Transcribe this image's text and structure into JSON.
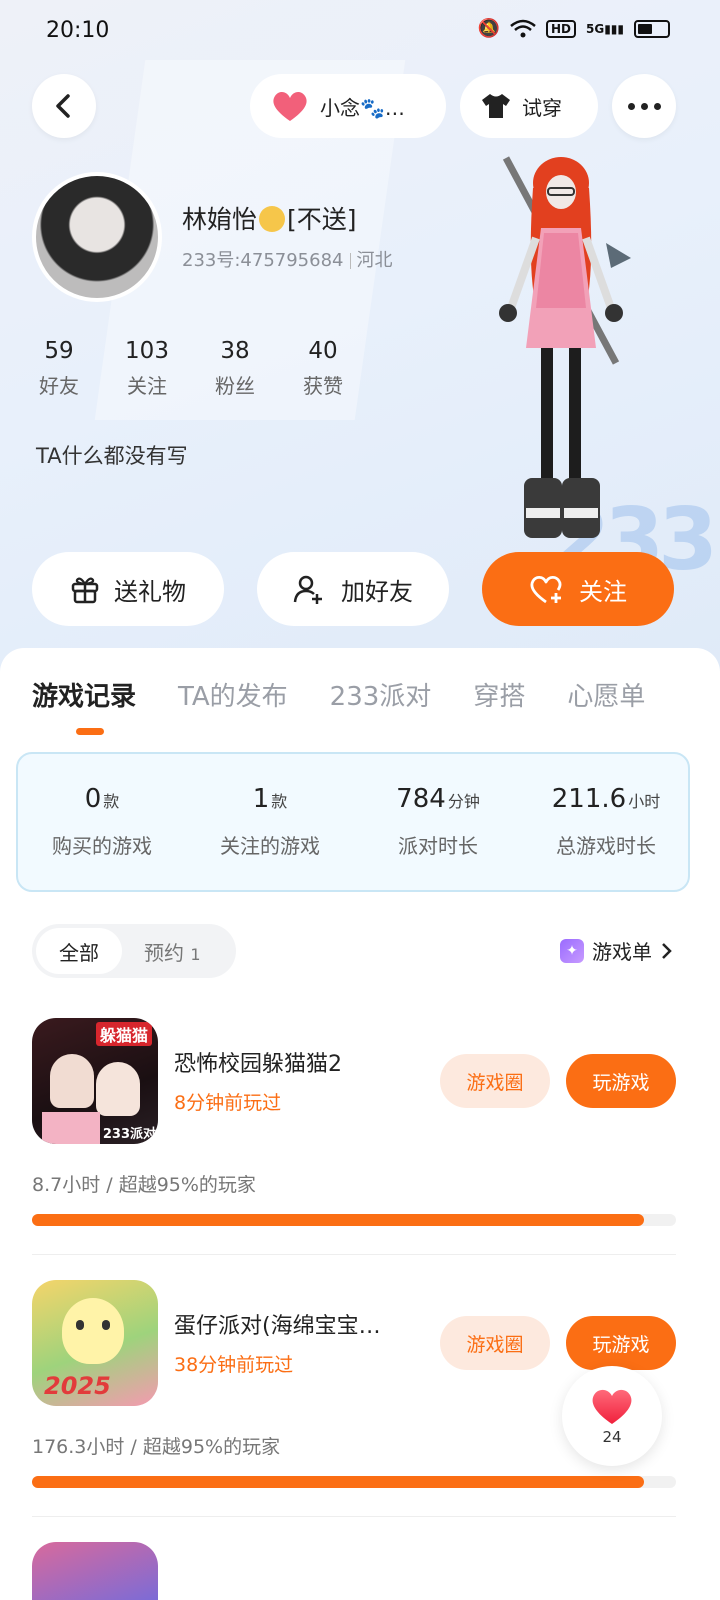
{
  "status": {
    "time": "20:10",
    "hd": "HD",
    "net": "5G"
  },
  "topnav": {
    "companion_label": "小念🐾…",
    "tryon_label": "试穿"
  },
  "profile": {
    "name": "林姢怡",
    "name_suffix": "[不送]",
    "id_text": "233号:475795684",
    "region": "河北",
    "bio": "TA什么都没有写",
    "stats": [
      {
        "value": "59",
        "label": "好友"
      },
      {
        "value": "103",
        "label": "关注"
      },
      {
        "value": "38",
        "label": "粉丝"
      },
      {
        "value": "40",
        "label": "获赞"
      }
    ]
  },
  "actions": {
    "gift": "送礼物",
    "add_friend": "加好友",
    "follow": "关注"
  },
  "tabs": [
    "游戏记录",
    "TA的发布",
    "233派对",
    "穿搭",
    "心愿单"
  ],
  "summary": [
    {
      "value": "0",
      "unit": "款",
      "label": "购买的游戏"
    },
    {
      "value": "1",
      "unit": "款",
      "label": "关注的游戏"
    },
    {
      "value": "784",
      "unit": "分钟",
      "label": "派对时长"
    },
    {
      "value": "211.6",
      "unit": "小时",
      "label": "总游戏时长"
    }
  ],
  "filters": {
    "all": "全部",
    "reserve": "预约",
    "reserve_count": "1",
    "game_list": "游戏单"
  },
  "games": [
    {
      "title": "恐怖校园躲猫猫2",
      "last_played": "8分钟前玩过",
      "circle_label": "游戏圈",
      "play_label": "玩游戏",
      "hours_text": "8.7小时 / 超越95%的玩家",
      "progress": 0.95,
      "thumb_text_top": "躲猫猫",
      "thumb_text_bottom": "233派对"
    },
    {
      "title": "蛋仔派对(海绵宝宝…",
      "last_played": "38分钟前玩过",
      "circle_label": "游戏圈",
      "play_label": "玩游戏",
      "hours_text": "176.3小时 / 超越95%的玩家",
      "progress": 0.95,
      "thumb_text_top": "2025"
    }
  ],
  "like_float": {
    "count": "24"
  },
  "colors": {
    "accent": "#fb6e14",
    "accent_light": "#fde9de",
    "summary_bg": "#f2faff"
  }
}
